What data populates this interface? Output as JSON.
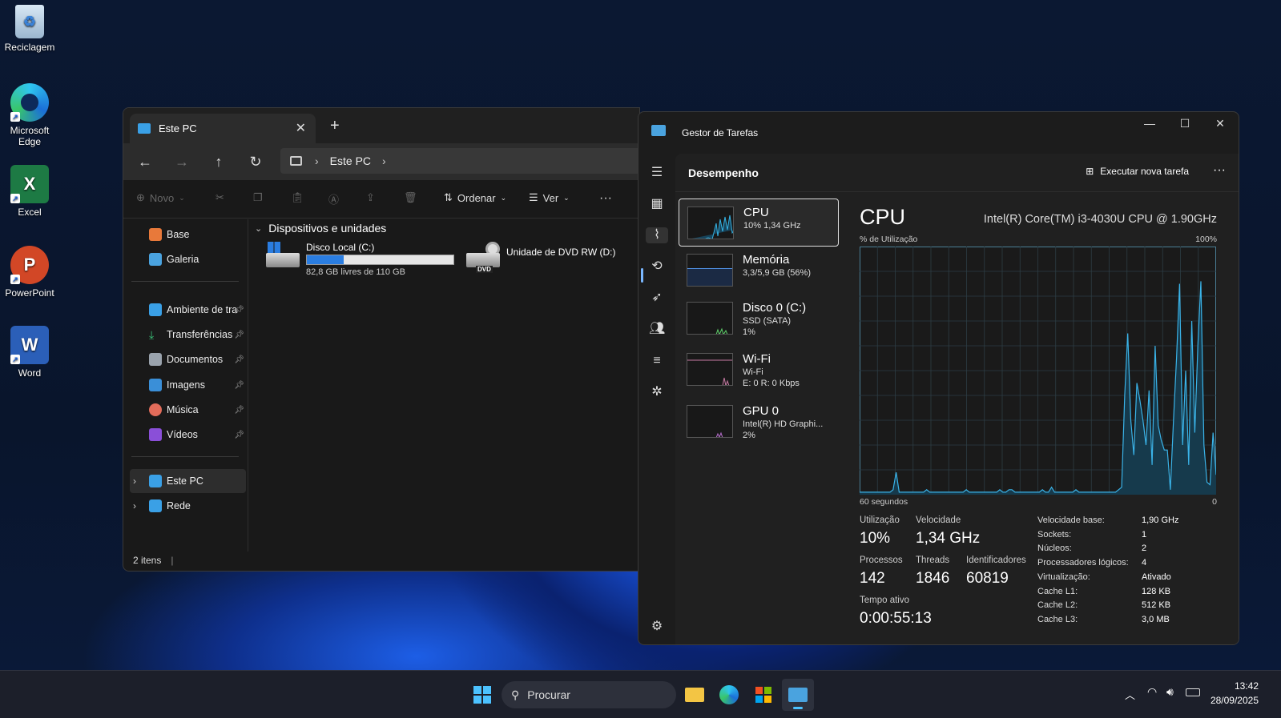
{
  "desktop": {
    "icons": [
      {
        "label": "Reciclagem",
        "icon": "recycle-bin-icon"
      },
      {
        "label": "Microsoft Edge",
        "icon": "edge-icon"
      },
      {
        "label": "Excel",
        "icon": "excel-icon"
      },
      {
        "label": "PowerPoint",
        "icon": "powerpoint-icon"
      },
      {
        "label": "Word",
        "icon": "word-icon"
      }
    ]
  },
  "explorer": {
    "tab_title": "Este PC",
    "address": "Este PC",
    "commands": {
      "new": "Novo",
      "sort": "Ordenar",
      "view": "Ver"
    },
    "sidebar": {
      "top": [
        {
          "label": "Base"
        },
        {
          "label": "Galeria"
        }
      ],
      "pinned": [
        {
          "label": "Ambiente de tra"
        },
        {
          "label": "Transferências"
        },
        {
          "label": "Documentos"
        },
        {
          "label": "Imagens"
        },
        {
          "label": "Música"
        },
        {
          "label": "Vídeos"
        }
      ],
      "bottom": [
        {
          "label": "Este PC"
        },
        {
          "label": "Rede"
        }
      ]
    },
    "group_header": "Dispositivos e unidades",
    "drives": [
      {
        "name": "Disco Local (C:)",
        "free_text": "82,8 GB livres de 110 GB",
        "used_fraction": 0.25
      },
      {
        "name": "Unidade de DVD RW (D:)",
        "badge": "DVD"
      }
    ],
    "status": "2 itens"
  },
  "taskmanager": {
    "title": "Gestor de Tarefas",
    "section": "Desempenho",
    "run_task": "Executar nova tarefa",
    "resources": [
      {
        "name": "CPU",
        "line2": "10% 1,34 GHz",
        "line3": ""
      },
      {
        "name": "Memória",
        "line2": "3,3/5,9 GB (56%)",
        "line3": ""
      },
      {
        "name": "Disco 0 (C:)",
        "line2": "SSD (SATA)",
        "line3": "1%"
      },
      {
        "name": "Wi-Fi",
        "line2": "Wi-Fi",
        "line3": "E: 0 R: 0 Kbps"
      },
      {
        "name": "GPU 0",
        "line2": "Intel(R) HD Graphi...",
        "line3": "2%"
      }
    ],
    "cpu": {
      "title": "CPU",
      "model": "Intel(R) Core(TM) i3-4030U CPU @ 1.90GHz",
      "graph_label": "% de Utilização",
      "graph_max": "100%",
      "graph_time": "60 segundos",
      "graph_zero": "0",
      "stats": {
        "utilization_label": "Utilização",
        "utilization": "10%",
        "speed_label": "Velocidade",
        "speed": "1,34 GHz",
        "processes_label": "Processos",
        "processes": "142",
        "threads_label": "Threads",
        "threads": "1846",
        "handles_label": "Identificadores",
        "handles": "60819",
        "uptime_label": "Tempo ativo",
        "uptime": "0:00:55:13"
      },
      "specs": [
        {
          "k": "Velocidade base:",
          "v": "1,90 GHz"
        },
        {
          "k": "Sockets:",
          "v": "1"
        },
        {
          "k": "Núcleos:",
          "v": "2"
        },
        {
          "k": "Processadores lógicos:",
          "v": "4"
        },
        {
          "k": "Virtualização:",
          "v": "Ativado"
        },
        {
          "k": "Cache L1:",
          "v": "128 KB"
        },
        {
          "k": "Cache L2:",
          "v": "512 KB"
        },
        {
          "k": "Cache L3:",
          "v": "3,0 MB"
        }
      ],
      "history": [
        1,
        1,
        1,
        1,
        1,
        1,
        1,
        1,
        1,
        1,
        1,
        2,
        9,
        1,
        1,
        1,
        1,
        1,
        1,
        1,
        1,
        1,
        2,
        1,
        1,
        1,
        1,
        1,
        1,
        1,
        1,
        1,
        1,
        1,
        1,
        2,
        1,
        1,
        1,
        1,
        1,
        1,
        1,
        1,
        1,
        1,
        2,
        1,
        1,
        2,
        2,
        1,
        1,
        1,
        1,
        1,
        1,
        1,
        1,
        1,
        2,
        1,
        1,
        3,
        1,
        1,
        1,
        1,
        1,
        1,
        1,
        2,
        1,
        1,
        1,
        1,
        1,
        1,
        1,
        1,
        1,
        1,
        1,
        1,
        1,
        2,
        3,
        40,
        65,
        30,
        16,
        45,
        38,
        30,
        20,
        42,
        12,
        60,
        28,
        22,
        18,
        18,
        2,
        30,
        55,
        85,
        20,
        50,
        12,
        70,
        25,
        60,
        86,
        20,
        5,
        4,
        25,
        8
      ]
    }
  },
  "taskbar": {
    "search_placeholder": "Procurar",
    "time": "13:42",
    "date": "28/09/2025"
  }
}
